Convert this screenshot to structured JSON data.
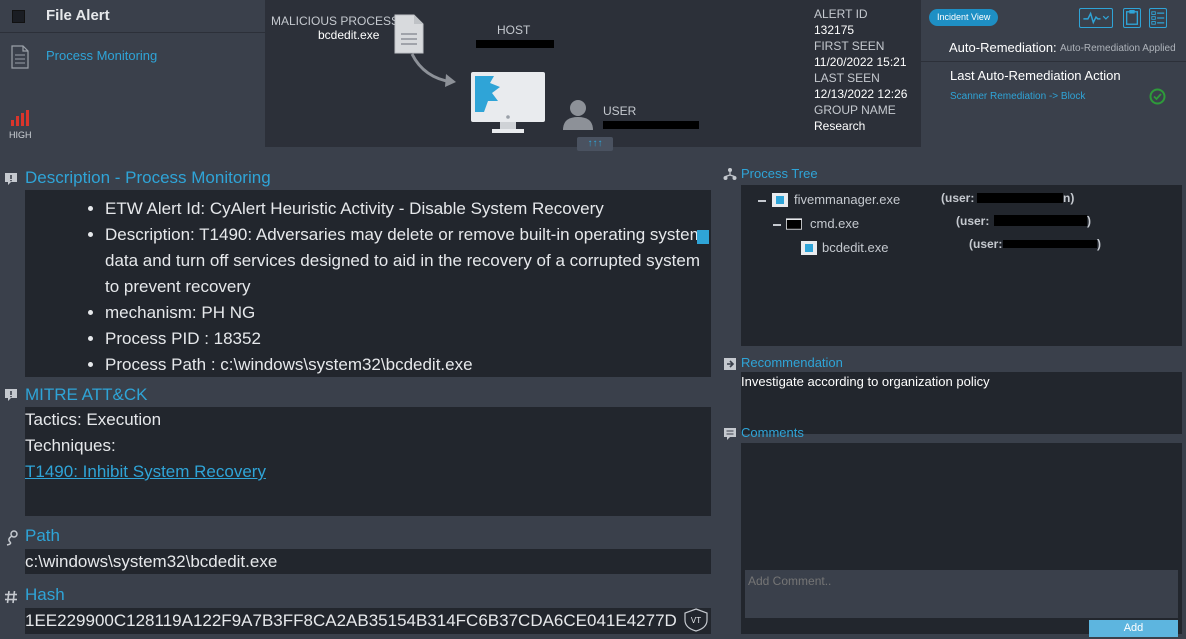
{
  "header": {
    "title": "File Alert",
    "nav_item": "Process Monitoring",
    "severity": "HIGH",
    "malicious_process_label": "MALICIOUS PROCESS",
    "malicious_process_value": "bcdedit.exe",
    "host_label": "HOST",
    "user_label": "USER",
    "expand_label": "↑↑↑"
  },
  "alert_info": {
    "alert_id_label": "ALERT ID",
    "alert_id": "132175",
    "first_seen_label": "FIRST SEEN",
    "first_seen": "11/20/2022 15:21",
    "last_seen_label": "LAST SEEN",
    "last_seen": "12/13/2022 12:26",
    "group_name_label": "GROUP NAME",
    "group_name": "Research"
  },
  "right_top": {
    "incident_view_label": "Incident View",
    "auto_remediation_label": "Auto-Remediation:",
    "auto_remediation_value": "Auto-Remediation Applied",
    "last_action_label": "Last Auto-Remediation Action",
    "last_action_value": "Scanner Remediation -> Block"
  },
  "description": {
    "title": "Description - Process Monitoring",
    "items": [
      "ETW Alert Id: CyAlert Heuristic Activity - Disable System Recovery",
      "Description: T1490: Adversaries may delete or remove built-in operating system data and turn off services designed to aid in the recovery of a corrupted system to prevent recovery",
      "mechanism: PH NG",
      "Process PID : 18352",
      "Process Path : c:\\windows\\system32\\bcdedit.exe"
    ]
  },
  "mitre": {
    "title": "MITRE ATT&CK",
    "tactics": "Tactics: Execution",
    "techniques_label": "Techniques:",
    "technique_link": "T1490: Inhibit System Recovery"
  },
  "path": {
    "title": "Path",
    "value": "c:\\windows\\system32\\bcdedit.exe"
  },
  "hash": {
    "title": "Hash",
    "value": "1EE229900C128119A122F9A7B3FF8CA2AB35154B314FC6B37CDA6CE041E4277D",
    "vt_label": "VT"
  },
  "process_tree": {
    "title": "Process Tree",
    "nodes": [
      {
        "name": "fivemmanager.exe",
        "user_label": "(user:",
        "user_suffix": "n)"
      },
      {
        "name": "cmd.exe",
        "user_label": "(user:",
        "user_suffix": ")"
      },
      {
        "name": "bcdedit.exe",
        "user_label": "(user:",
        "user_suffix": ")"
      }
    ]
  },
  "recommendation": {
    "title": "Recommendation",
    "text": "Investigate according to organization policy"
  },
  "comments": {
    "title": "Comments",
    "placeholder": "Add Comment..",
    "add_label": "Add"
  },
  "colors": {
    "accent": "#2fa4d7",
    "severity_high": "#d9352b",
    "success": "#2e9b3a"
  }
}
